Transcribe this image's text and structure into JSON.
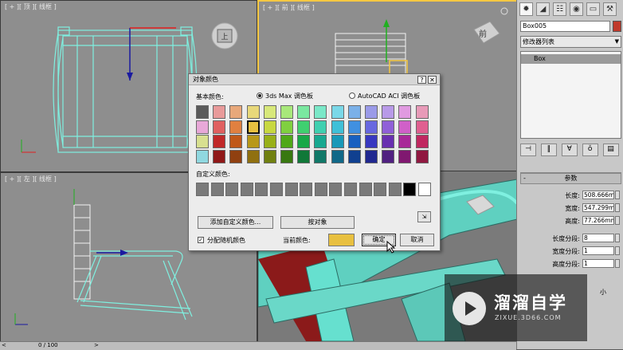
{
  "viewports": {
    "top_label": "[ + ][ 顶 ][ 线框 ]",
    "front_label": "[ + ][ 前 ][ 线框 ]",
    "left_label": "[ + ][ 左 ][ 线框 ]",
    "top_cube": "上",
    "front_cube": "前"
  },
  "command_panel": {
    "object_name": "Box005",
    "object_color": "#c0392b",
    "modifier_list": "修改器列表",
    "stack_item": "Box",
    "rollout_title": "参数",
    "params": [
      {
        "label": "长度:",
        "value": "508.666m"
      },
      {
        "label": "宽度:",
        "value": "547.299m"
      },
      {
        "label": "高度:",
        "value": "77.266mm"
      },
      {
        "label": "长度分段:",
        "value": "8"
      },
      {
        "label": "宽度分段:",
        "value": "1"
      },
      {
        "label": "高度分段:",
        "value": "1"
      }
    ],
    "tail_text": "小"
  },
  "dialog": {
    "title": "对象颜色",
    "help": "?",
    "close": "✕",
    "basic_colors_label": "基本颜色:",
    "palette_max": "3ds Max 调色板",
    "palette_acad": "AutoCAD ACI 调色板",
    "custom_colors_label": "自定义颜色:",
    "add_custom_button": "添加自定义颜色...",
    "by_object_button": "按对象",
    "assign_random_label": "分配随机颜色",
    "current_color_label": "当前颜色:",
    "current_color": "#e8c040",
    "ok_button": "确定",
    "cancel_button": "取消",
    "swatch_rows": [
      [
        "#5a5a5a",
        "#e89a9a",
        "#e8a87a",
        "#e8d87a",
        "#d8e87a",
        "#a8e87a",
        "#7ae8a0",
        "#7ae8c8",
        "#7ad8e8",
        "#7ab0e8",
        "#9a9ae8",
        "#b89ae8",
        "#e09ae0",
        "#e89ab8"
      ],
      [
        "#e8a8d8",
        "#e06060",
        "#e08040",
        "#e8c040",
        "#c8d840",
        "#80d040",
        "#40d070",
        "#40d0b0",
        "#40c0d8",
        "#4090e0",
        "#6868e0",
        "#9060d8",
        "#d060c8",
        "#e06090"
      ],
      [
        "#d8e090",
        "#c02828",
        "#c05818",
        "#b89818",
        "#98b018",
        "#50a818",
        "#18a848",
        "#18a890",
        "#1898b8",
        "#1860c0",
        "#3838c0",
        "#6830b0",
        "#a82898",
        "#c02860"
      ],
      [
        "#90d8e0",
        "#901818",
        "#904010",
        "#907010",
        "#708010",
        "#387810",
        "#107838",
        "#107868",
        "#106888",
        "#104090",
        "#202890",
        "#502080",
        "#801870",
        "#901840"
      ]
    ],
    "custom_swatches": [
      "#7a7a7a",
      "#7a7a7a",
      "#7a7a7a",
      "#7a7a7a",
      "#7a7a7a",
      "#7a7a7a",
      "#7a7a7a",
      "#7a7a7a",
      "#7a7a7a",
      "#7a7a7a",
      "#7a7a7a",
      "#7a7a7a",
      "#7a7a7a",
      "#7a7a7a",
      "#000000",
      "#ffffff"
    ]
  },
  "status": {
    "frame": "0 / 100"
  },
  "watermark": {
    "brand": "溜溜自学",
    "url": "ZIXUE.3D66.COM"
  }
}
